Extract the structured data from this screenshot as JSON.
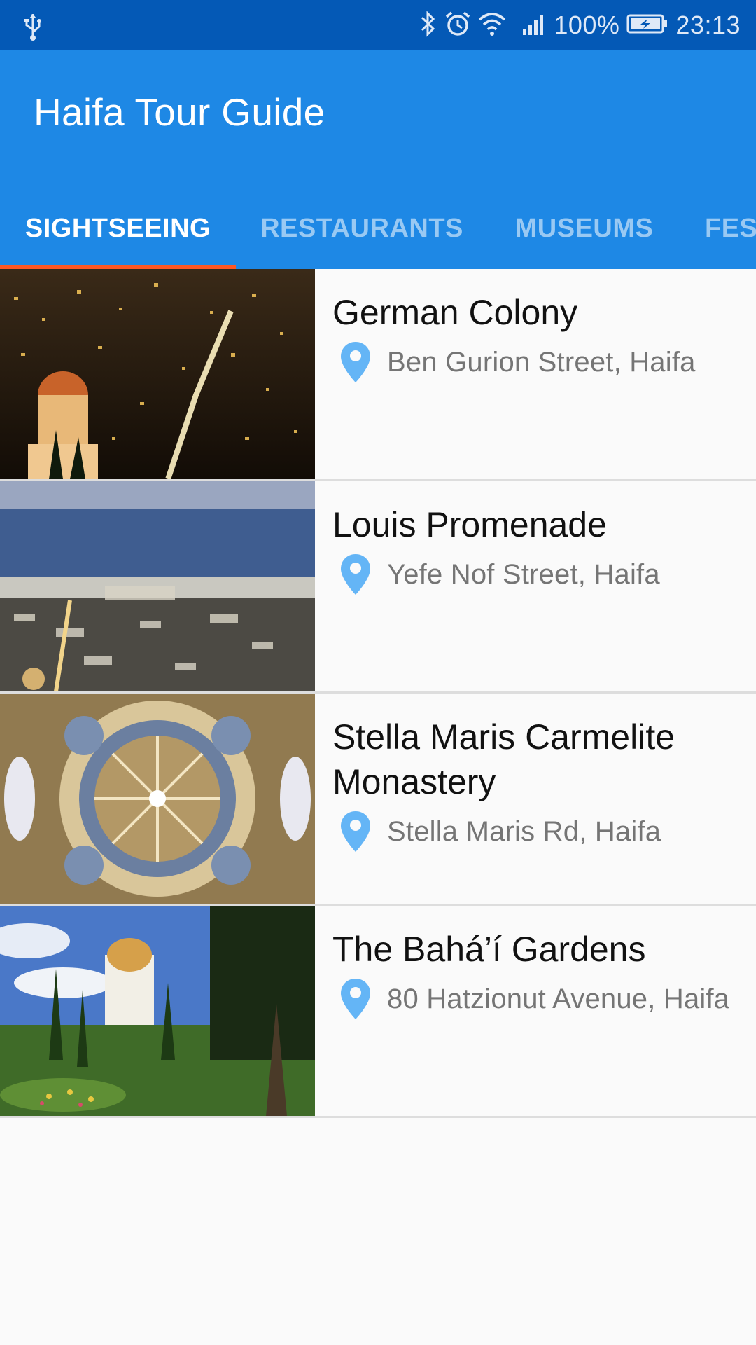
{
  "status_bar": {
    "battery_percent": "100%",
    "time": "23:13",
    "icons": [
      "usb-icon",
      "bluetooth-icon",
      "alarm-icon",
      "wifi-icon",
      "signal-icon",
      "battery-charging-icon"
    ]
  },
  "app": {
    "title": "Haifa Tour Guide",
    "primary_color": "#1e88e5",
    "status_color": "#0459b6",
    "indicator_color": "#ff5722"
  },
  "tabs": [
    {
      "label": "SIGHTSEEING",
      "active": true
    },
    {
      "label": "RESTAURANTS",
      "active": false
    },
    {
      "label": "MUSEUMS",
      "active": false
    },
    {
      "label": "FESTIVALS",
      "active": false
    }
  ],
  "places": [
    {
      "name": "German Colony",
      "address": "Ben Gurion Street, Haifa",
      "image": "city-night-photo"
    },
    {
      "name": "Louis Promenade",
      "address": "Yefe Nof Street, Haifa",
      "image": "bay-view-photo"
    },
    {
      "name": "Stella Maris Carmelite Monastery",
      "address": "Stella Maris Rd, Haifa",
      "image": "dome-ceiling-photo"
    },
    {
      "name": "The Bahá’í Gardens",
      "address": "80 Hatzionut Avenue, Haifa",
      "image": "gardens-shrine-photo"
    }
  ],
  "pin_icon_color": "#64b5f6"
}
